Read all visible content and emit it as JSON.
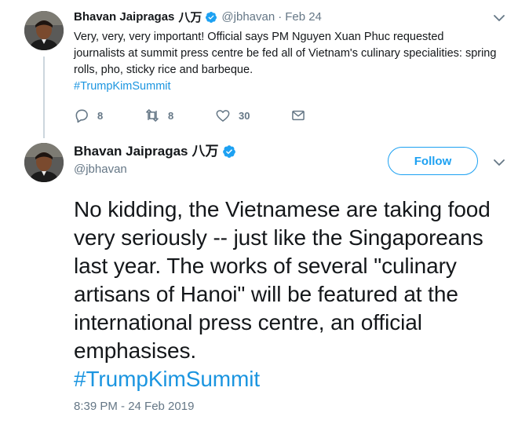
{
  "tweet1": {
    "author_name": "Bhavan Jaipragas",
    "author_cjk": "八万",
    "handle": "@jbhavan",
    "separator": "·",
    "date": "Feb 24",
    "text": "Very, very, very important! Official says PM Nguyen Xuan Phuc requested journalists at summit press centre be fed all of Vietnam's culinary specialities: spring rolls, pho, sticky rice and barbeque.",
    "hashtag": "#TrumpKimSummit",
    "reply_count": "8",
    "retweet_count": "8",
    "like_count": "30"
  },
  "tweet2": {
    "author_name": "Bhavan Jaipragas",
    "author_cjk": "八万",
    "handle": "@jbhavan",
    "follow_label": "Follow",
    "text": "No kidding, the Vietnamese are taking food very seriously -- just like the Singaporeans last year. The works of several \"culinary artisans of Hanoi\" will be featured at the international press centre, an official emphasises.",
    "hashtag": "#TrumpKimSummit",
    "timestamp": "8:39 PM - 24 Feb 2019"
  },
  "colors": {
    "link": "#1b95e0",
    "verified": "#1da1f2",
    "muted": "#657786",
    "thread_line": "#ccd6dd"
  },
  "icons": [
    "verified-badge-icon",
    "chevron-down-icon",
    "reply-icon",
    "retweet-icon",
    "like-icon",
    "direct-message-icon"
  ]
}
